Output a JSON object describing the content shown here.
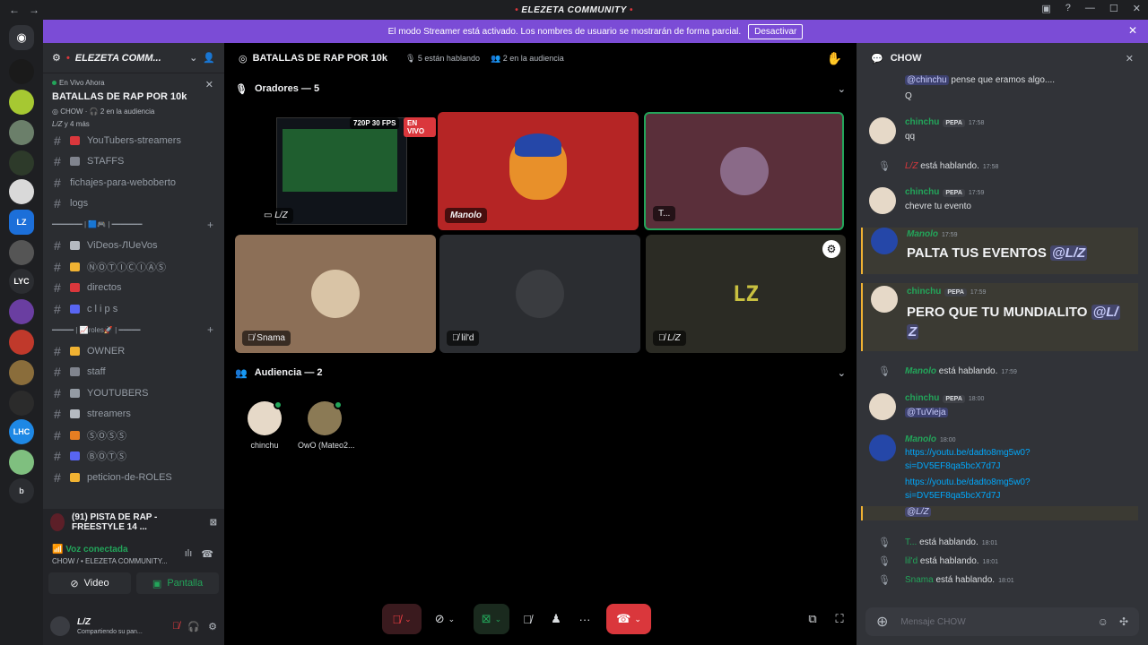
{
  "window": {
    "title": "ELEZETA COMMUNITY",
    "title_prefix": "•",
    "title_suffix": "•"
  },
  "banner": {
    "text": "El modo Streamer está activado. Los nombres de usuario se mostrarán de forma parcial.",
    "button": "Desactivar"
  },
  "server": {
    "name": "ELEZETA COMM...",
    "prefix": "•"
  },
  "live": {
    "badge": "En Vivo Ahora",
    "title": "BATALLAS DE RAP POR 10k",
    "channel": "CHOW",
    "audience": "2 en la audiencia",
    "speakers": "L/Z",
    "more": "y 4 más"
  },
  "channels": [
    {
      "label": "YouTubers-streamers",
      "color": "#da373c"
    },
    {
      "label": "STAFFS",
      "color": "#80848e"
    },
    {
      "label": "fichajes-para-weboberto",
      "color": ""
    },
    {
      "label": "logs",
      "color": ""
    }
  ],
  "categories": [
    "━━━━━━━ | 🟦🎮 | ━━━━━━━",
    "━━━━━ | 📈roles🚀 | ━━━━━"
  ],
  "channels2": [
    {
      "label": "ViDeos-ЛUeVos",
      "color": "#b5bac1"
    },
    {
      "label": "ⓃⓄⓉⒾⒸⒾⒶⓈ",
      "color": "#f0b232"
    },
    {
      "label": "directos",
      "color": "#da373c"
    },
    {
      "label": "c l i p s",
      "color": "#5865f2"
    }
  ],
  "channels3": [
    {
      "label": "OWNER",
      "color": "#f0b232"
    },
    {
      "label": "staff",
      "color": "#80848e"
    },
    {
      "label": "YOUTUBERS",
      "color": "#949ba4"
    },
    {
      "label": "streamers",
      "color": "#b5bac1"
    },
    {
      "label": "ⓈⓄⓈⓈ",
      "color": "#e67e22"
    },
    {
      "label": "ⒷⓄⓉⓈ",
      "color": "#5865f2"
    },
    {
      "label": "peticion-de-ROLES",
      "color": "#f0b232"
    }
  ],
  "rtc": {
    "stream_title": "(91) PISTA DE RAP - FREESTYLE 14 ...",
    "status": "Voz conectada",
    "location": "CHOW / • ELEZETA COMMUNITY...",
    "video": "Video",
    "screen": "Pantalla"
  },
  "user": {
    "name": "L/Z",
    "status": "Compartiendo su pan..."
  },
  "stage": {
    "title": "BATALLAS DE RAP POR 10k",
    "speaking": "5 están hablando",
    "audience": "2 en la audiencia",
    "speakers_header": "Oradores — 5",
    "audience_header": "Audiencia — 2",
    "stream_quality": "720P 30 FPS",
    "live_badge": "EN VIVO",
    "tiles": [
      "L/Z",
      "Manolo",
      "T...",
      "Snama",
      "lil'd",
      "L/Z"
    ],
    "audience_members": [
      "chinchu",
      "OwO (Mateo2..."
    ]
  },
  "chat": {
    "title": "CHOW",
    "placeholder": "Mensaje CHOW",
    "m0_text": "pense que eramos algo....",
    "m0_mention": "@chinchu",
    "m0_line2": "Q",
    "m1_name": "chinchu",
    "m1_tag": "PEPA",
    "m1_time": "17:58",
    "m1_text": "qq",
    "s1_name": "L/Z",
    "s1_text": "está hablando.",
    "s1_time": "17:58",
    "m2_name": "chinchu",
    "m2_tag": "PEPA",
    "m2_time": "17:59",
    "m2_text": "chevre tu evento",
    "m3_name": "Manolo",
    "m3_time": "17:59",
    "m3_text": "PALTA TUS EVENTOS",
    "m3_mention": "@L/Z",
    "m4_name": "chinchu",
    "m4_tag": "PEPA",
    "m4_time": "17:59",
    "m4_text": "PERO QUE TU MUNDIALITO",
    "m4_mention": "@L/",
    "m4_mention2": "Z",
    "s2_name": "Manolo",
    "s2_text": "está hablando.",
    "s2_time": "17:59",
    "m5_name": "chinchu",
    "m5_tag": "PEPA",
    "m5_time": "18:00",
    "m5_text": "@TuVieja",
    "m6_name": "Manolo",
    "m6_time": "18:00",
    "m6_link1a": "https://youtu.be/dadto8mg5w0?",
    "m6_link1b": "si=DV5EF8qa5bcX7d7J",
    "m6_link2a": "https://youtu.be/dadto8mg5w0?",
    "m6_link2b": "si=DV5EF8qa5bcX7d7J",
    "m6_mention": "@L/Z",
    "s3_name": "T...",
    "s3_text": "está hablando.",
    "s3_time": "18:01",
    "s4_name": "lil'd",
    "s4_text": "está hablando.",
    "s4_time": "18:01",
    "s5_name": "Snama",
    "s5_text": "está hablando.",
    "s5_time": "18:01"
  },
  "colors": {
    "accent": "#5865f2",
    "green": "#23a55a",
    "red": "#da373c",
    "banner": "#7b4cd6",
    "manolo_tile": "#b52525",
    "t_tile": "#5a2f3a",
    "snama_tile": "#8c6f57"
  }
}
